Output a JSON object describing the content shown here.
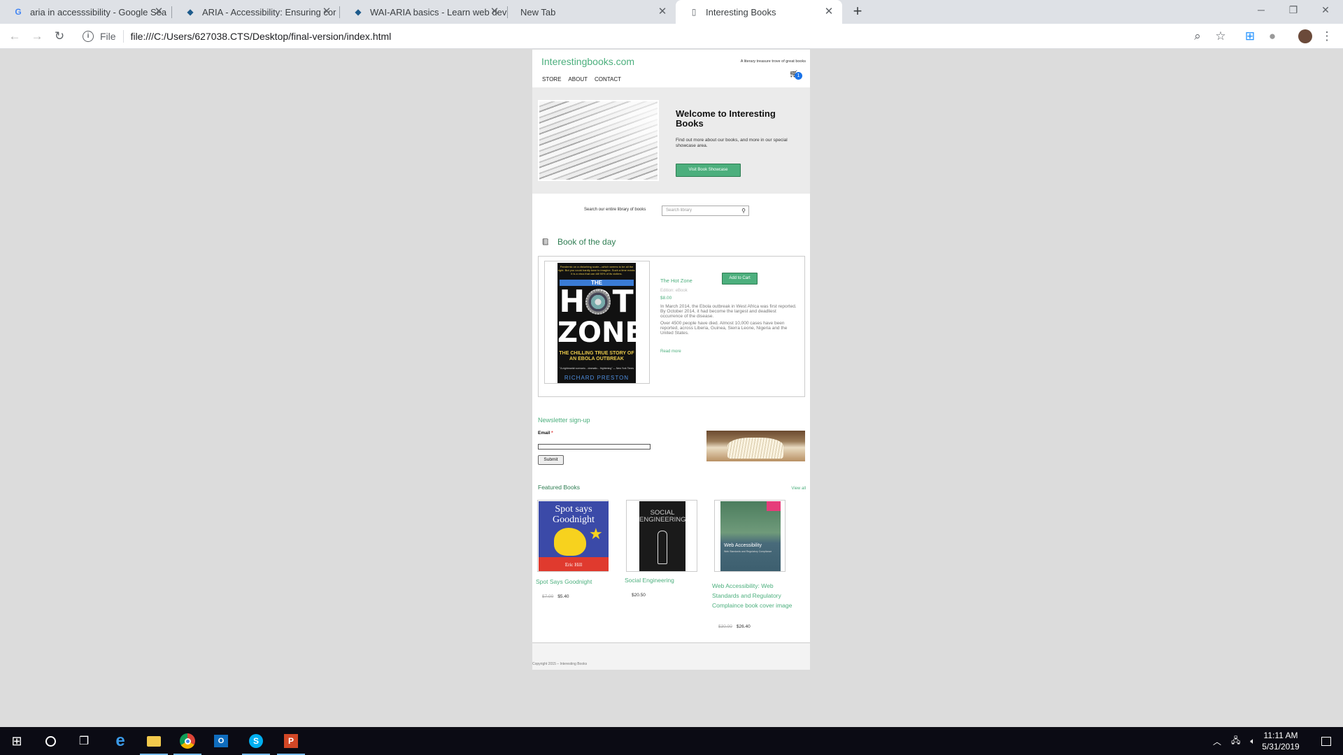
{
  "browser": {
    "tabs": [
      {
        "title": "aria in accesssibility - Google Sea",
        "favicon": "google-icon"
      },
      {
        "title": "ARIA - Accessibility: Ensuring cor",
        "favicon": "mdn-icon"
      },
      {
        "title": "WAI-ARIA basics - Learn web dev",
        "favicon": "mdn-icon"
      },
      {
        "title": "New Tab",
        "favicon": "none"
      },
      {
        "title": "Interesting Books",
        "favicon": "page-icon",
        "active": true
      }
    ],
    "address": {
      "scheme_label": "File",
      "url": "file:///C:/Users/627038.CTS/Desktop/final-version/index.html"
    }
  },
  "site": {
    "logo": "Interestingbooks.com",
    "tagline": "A literary treasure trove of great books",
    "nav": [
      "STORE",
      "ABOUT",
      "CONTACT"
    ],
    "cart_count": "1",
    "hero": {
      "title": "Welcome to Interesting Books",
      "text": "Find out more about our books, and more in our special showcase area.",
      "button": "Visit Book Showcase"
    },
    "search": {
      "label": "Search our entire library of books",
      "placeholder": "Search library"
    },
    "book_of_the_day": {
      "heading": "Book of the day",
      "cover": {
        "top_text": "Pandemic on a disturbing scale—which seems to be all the right. But you could hardly bear to imagine. Such a time exists: it is a virus that can kill 90% of its victims.",
        "the": "THE",
        "title_top": "HOT",
        "title_bottom": "ZONE",
        "subtitle": "THE CHILLING TRUE STORY OF AN EBOLA OUTBREAK",
        "quote": "\"A nightmarish scenario... dramatic... frightening\" — New York Times",
        "author": "RICHARD PRESTON"
      },
      "title": "The Hot Zone",
      "edition": "Edition: eBook",
      "price": "$8.00",
      "desc1": "In March 2014, the Ebola outbreak in West Africa was first reported. By October 2014, it had become the largest and deadliest occurrence of the disease.",
      "desc2": "Over 4500 people have died. Almost 10,000 cases have been reported, across Liberia, Guinea, Sierra Leone, Nigeria and the United States.",
      "read_more": "Read more",
      "add_to_cart": "Add to Cart"
    },
    "newsletter": {
      "heading": "Newsletter sign-up",
      "email_label": "Email",
      "required_mark": "*",
      "submit": "Submit"
    },
    "featured": {
      "heading": "Featured Books",
      "view_all": "View all",
      "books": [
        {
          "name": "Spot Says Goodnight",
          "old_price": "$7.00",
          "price": "$5.40",
          "cover_title": "Spot says Goodnight",
          "cover_author": "Eric Hill"
        },
        {
          "name": "Social Engineering",
          "old_price": "",
          "price": "$20.50",
          "cover_title": "SOCIAL ENGINEERING"
        },
        {
          "name": "Web Accessibility: Web Standards and Regulatory Complaince book cover image",
          "old_price": "$30.00",
          "price": "$26.40",
          "cover_title": "Web Accessibility",
          "cover_subtitle": "Web Standards and Regulatory Compliance"
        }
      ]
    },
    "footer": "Copyright 2015 – Interesting Books"
  },
  "taskbar": {
    "time": "11:11 AM",
    "date": "5/31/2019"
  },
  "colors": {
    "accent": "#4caf7d",
    "accent_dark": "#2e7d52",
    "badge": "#1a73e8"
  }
}
